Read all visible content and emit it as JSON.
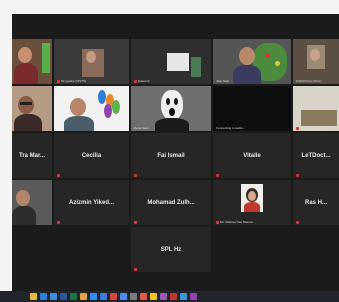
{
  "window": {
    "app": "Zoom Meeting"
  },
  "colors": {
    "background": "#1b1b1b",
    "tile": "#262626",
    "muted_mic": "#d33333",
    "active_speaker": "#f2c94c"
  },
  "row1": [
    {
      "caption": ""
    },
    {
      "caption": "Nk lgoabe (WSTS)"
    },
    {
      "caption": "jkdeer12"
    },
    {
      "caption": "Julie Soto"
    },
    {
      "caption": "D&D03 Feet (Pers)"
    }
  ],
  "row2": [
    {
      "caption": ""
    },
    {
      "caption": ""
    },
    {
      "caption": "Rana Sami"
    },
    {
      "caption": "Connecting to audio..."
    },
    {
      "caption": "FOR (Employee)"
    }
  ],
  "row3": [
    {
      "name": "Tra Mar..."
    },
    {
      "name": "Cecilia"
    },
    {
      "name": "Fai Ismail"
    },
    {
      "name": "Vitalie"
    },
    {
      "name": "LeTDoct..."
    }
  ],
  "row4": [
    {
      "caption": ""
    },
    {
      "name": "Azizmin Yiked..."
    },
    {
      "name": "Mohamad Zulh..."
    },
    {
      "caption": "Dk. Marissa Nas Nasuno..."
    },
    {
      "name": "Ras H..."
    }
  ],
  "row5": [
    {
      "name": "SPL Hz"
    }
  ],
  "taskbar": {
    "icons": [
      "file-explorer-icon",
      "browser-icon",
      "mail-icon",
      "word-icon",
      "excel-icon",
      "chat-icon",
      "zoom-icon",
      "photos-icon",
      "chrome-icon",
      "calendar-icon",
      "settings-icon",
      "media-icon",
      "app-icon"
    ]
  }
}
